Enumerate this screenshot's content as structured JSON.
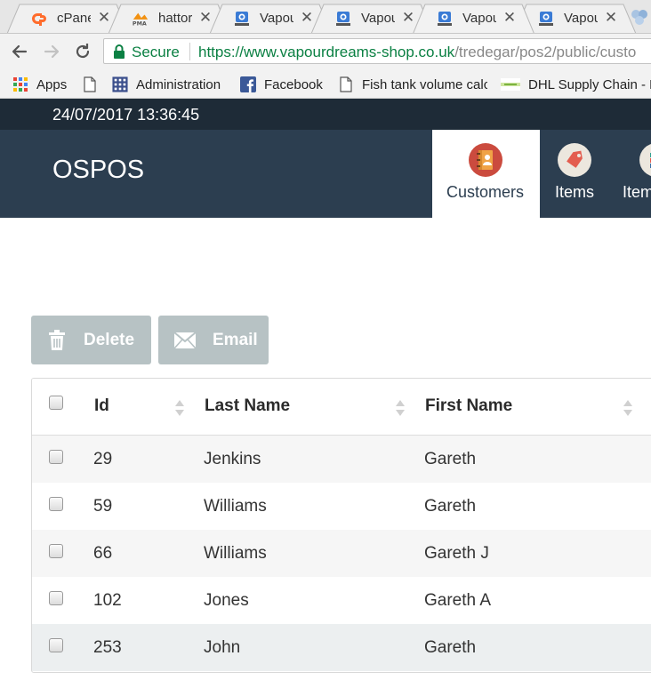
{
  "browser": {
    "tabs": [
      {
        "title": "cPane",
        "favicon": "cpanel-icon",
        "active": false
      },
      {
        "title": "hattor",
        "favicon": "phpmyadmin-icon",
        "active": false
      },
      {
        "title": "Vapou",
        "favicon": "ospos-icon",
        "active": false
      },
      {
        "title": "Vapou",
        "favicon": "ospos-icon",
        "active": false
      },
      {
        "title": "Vapou",
        "favicon": "ospos-icon",
        "active": true
      },
      {
        "title": "Vapou",
        "favicon": "ospos-icon",
        "active": false
      }
    ],
    "close_glyph": "✕",
    "address": {
      "secure_label": "Secure",
      "url_host": "https://www.vapourdreams-shop.co.uk",
      "url_path": "/tredegar/pos2/public/custo"
    },
    "bookmarks": [
      {
        "label": "Apps",
        "icon": "apps-grid-icon"
      },
      {
        "label": "",
        "icon": "page-icon"
      },
      {
        "label": "Administration",
        "icon": "admin-grid-icon"
      },
      {
        "label": "Facebook",
        "icon": "facebook-icon"
      },
      {
        "label": "Fish tank volume calc",
        "icon": "page-icon"
      },
      {
        "label": "DHL Supply Chain - L",
        "icon": "dhl-icon"
      }
    ]
  },
  "app": {
    "datetime": "24/07/2017 13:36:45",
    "brand": "OSPOS",
    "modules": [
      {
        "label": "Customers",
        "icon": "customers-icon",
        "active": true
      },
      {
        "label": "Items",
        "icon": "items-tag-icon",
        "active": false
      },
      {
        "label": "Item",
        "icon": "item-kits-icon",
        "active": false
      }
    ],
    "actions": {
      "delete_label": "Delete",
      "email_label": "Email"
    },
    "table": {
      "columns": [
        "Id",
        "Last Name",
        "First Name"
      ],
      "rows": [
        {
          "id": "29",
          "last_name": "Jenkins",
          "first_name": "Gareth"
        },
        {
          "id": "59",
          "last_name": "Williams",
          "first_name": "Gareth"
        },
        {
          "id": "66",
          "last_name": "Williams",
          "first_name": "Gareth J"
        },
        {
          "id": "102",
          "last_name": "Jones",
          "first_name": "Gareth A"
        },
        {
          "id": "253",
          "last_name": "John",
          "first_name": "Gareth"
        }
      ]
    },
    "colors": {
      "topbar": "#1e2b37",
      "navbar": "#2c3e50",
      "action_button": "#b7c2c4",
      "secure_green": "#0b8043"
    }
  }
}
